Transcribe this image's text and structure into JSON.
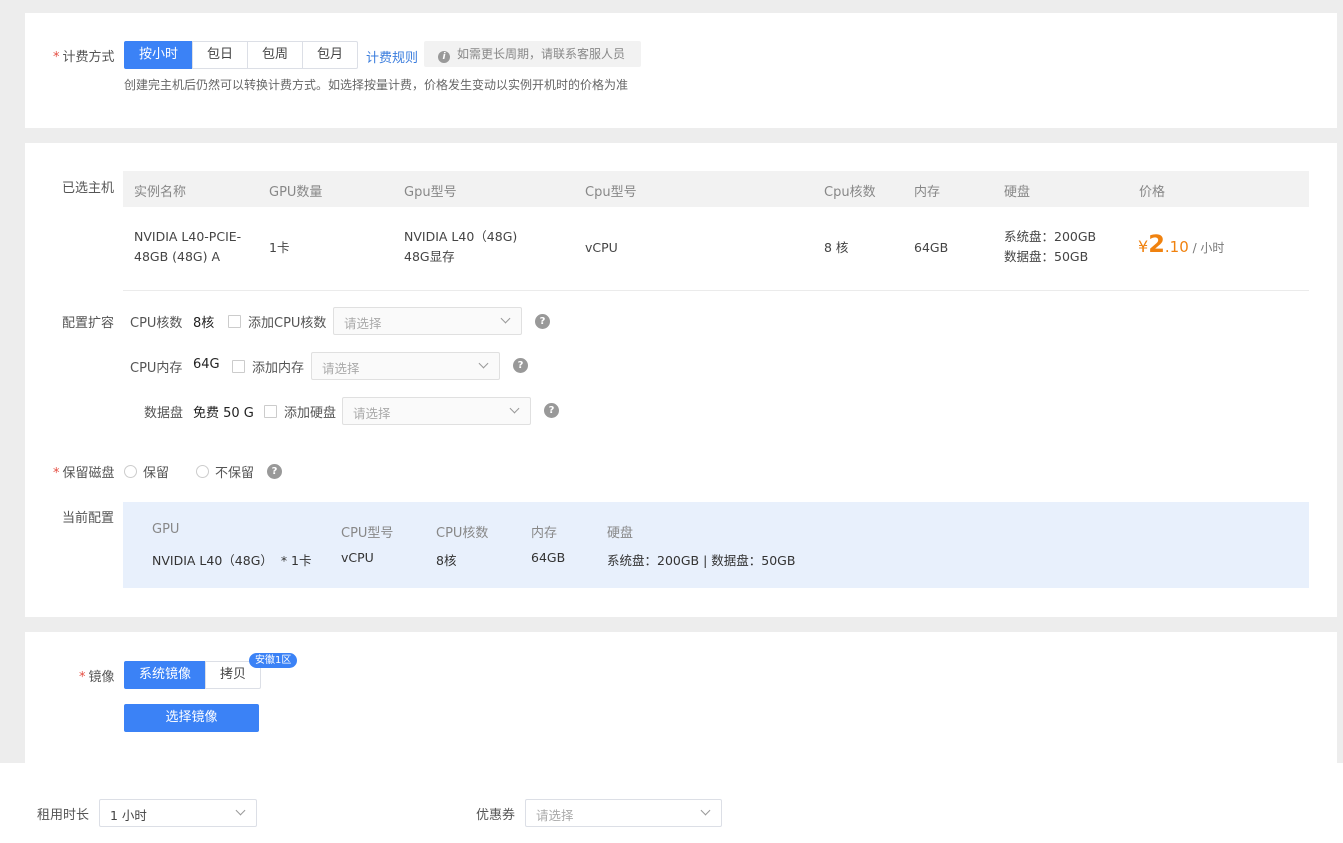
{
  "billing": {
    "label": "计费方式",
    "options": [
      "按小时",
      "包日",
      "包周",
      "包月"
    ],
    "selected": "按小时",
    "rules_link": "计费规则",
    "tip": "如需更长周期，请联系客服人员",
    "hint": "创建完主机后仍然可以转换计费方式。如选择按量计费，价格发生变动以实例开机时的价格为准"
  },
  "selected_host": {
    "label": "已选主机",
    "headers": [
      "实例名称",
      "GPU数量",
      "Gpu型号",
      "Cpu型号",
      "Cpu核数",
      "内存",
      "硬盘",
      "价格"
    ],
    "row": {
      "name_line1": "NVIDIA L40-PCIE-",
      "name_line2": "48GB (48G) A",
      "gpu_count": "1卡",
      "gpu_model_line1": "NVIDIA L40（48G)",
      "gpu_model_line2": "48G显存",
      "cpu_model": "vCPU",
      "cpu_cores": "8 核",
      "memory": "64GB",
      "disk_system": "系统盘：200GB",
      "disk_data": "数据盘：50GB",
      "price_currency": "¥",
      "price_int": "2",
      "price_dec": ".10",
      "price_unit": " / 小时"
    }
  },
  "expansion": {
    "label": "配置扩容",
    "cpu": {
      "label": "CPU核数",
      "value": "8核",
      "add_label": "添加CPU核数",
      "placeholder": "请选择"
    },
    "memory": {
      "label": "CPU内存",
      "value": "64G",
      "add_label": "添加内存",
      "placeholder": "请选择"
    },
    "disk": {
      "label": "数据盘",
      "value": "免费 50 G",
      "add_label": "添加硬盘",
      "placeholder": "请选择"
    },
    "help": "?"
  },
  "keep_disk": {
    "label": "保留磁盘",
    "options": [
      "保留",
      "不保留"
    ]
  },
  "current_config": {
    "label": "当前配置",
    "headers": [
      "GPU",
      "CPU型号",
      "CPU核数",
      "内存",
      "硬盘"
    ],
    "values": [
      "NVIDIA L40（48G）  * 1卡",
      "vCPU",
      "8核",
      "64GB",
      "系统盘：200GB | 数据盘：50GB"
    ]
  },
  "image": {
    "label": "镜像",
    "options": [
      "系统镜像",
      "拷贝"
    ],
    "selected": "系统镜像",
    "badge": "安徽1区",
    "select_button": "选择镜像"
  },
  "footer": {
    "rent_label": "租用时长",
    "rent_value": "1 小时",
    "coupon_label": "优惠券",
    "coupon_placeholder": "请选择"
  },
  "colors": {
    "accent": "#3b82f6",
    "price": "#f0820f",
    "required": "#e54d42"
  }
}
